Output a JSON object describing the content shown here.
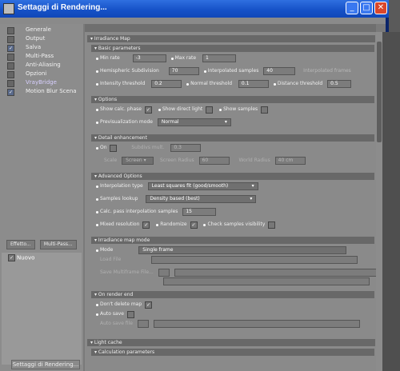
{
  "window": {
    "title": "Settaggi di Rendering..."
  },
  "nav": {
    "items": [
      {
        "label": "Generale",
        "checked": false
      },
      {
        "label": "Output",
        "checked": false
      },
      {
        "label": "Salva",
        "checked": true
      },
      {
        "label": "Multi-Pass",
        "checked": false
      },
      {
        "label": "Anti-Aliasing",
        "checked": false
      },
      {
        "label": "Opzioni",
        "checked": false
      },
      {
        "label": "VrayBridge",
        "checked": false
      },
      {
        "label": "Motion Blur Scena",
        "checked": true
      }
    ],
    "effect_button": "Effetto...",
    "multipass_button": "Multi-Pass...",
    "new_item": "Nuovo",
    "bottom_button": "Settaggi di Rendering..."
  },
  "panel": {
    "irradiance_map": "Irradiance Map",
    "basic_parameters": "Basic parameters",
    "min_rate_label": "Min rate",
    "min_rate": "-3",
    "max_rate_label": "Max rate",
    "max_rate": "1",
    "hemispheric_label": "Hemispheric Subdivision",
    "hemispheric": "70",
    "interpolated_label": "Interpolated samples",
    "interpolated": "40",
    "interpolated_frames_label": "Interpolated frames",
    "intensity_label": "Intensity threshold",
    "intensity": "0.2",
    "normal_label": "Normal threshold",
    "normal": "0.1",
    "distance_label": "Distance threshold",
    "distance": "0.5",
    "options": "Options",
    "show_calc_label": "Show calc. phase",
    "show_direct_label": "Show direct light",
    "show_samples_label": "Show samples",
    "previs_label": "Previsualization mode",
    "previs": "Normal",
    "detail": "Detail enhancement",
    "on_label": "On",
    "subdivs_label": "Subdivs mult.",
    "subdivs": "0.3",
    "scale_label": "Scale",
    "scale": "Screen",
    "screen_radius_label": "Screen Radius",
    "screen_radius": "60",
    "world_radius_label": "World Radius",
    "world_radius": "40 cm",
    "advanced": "Advanced Options",
    "interp_type_label": "Interpolation type",
    "interp_type": "Least squares fit (good/smooth)",
    "lookup_label": "Samples lookup",
    "lookup": "Density based (best)",
    "calc_pass_label": "Calc. pass interpolation samples",
    "calc_pass": "15",
    "mixed_label": "Mixed resolution",
    "randomize_label": "Randomize",
    "check_vis_label": "Check samples visibility",
    "irr_mode": "Irradiance map mode",
    "mode_label": "Mode",
    "mode": "Single frame",
    "load_file_label": "Load File",
    "save_multi_label": "Save Multiframe File...",
    "on_render_end": "On render end",
    "dont_delete_label": "Don't delete map",
    "auto_save_label": "Auto save",
    "auto_save_file_label": "Auto save file",
    "light_cache": "Light cache",
    "calc_params": "Calculation parameters"
  }
}
